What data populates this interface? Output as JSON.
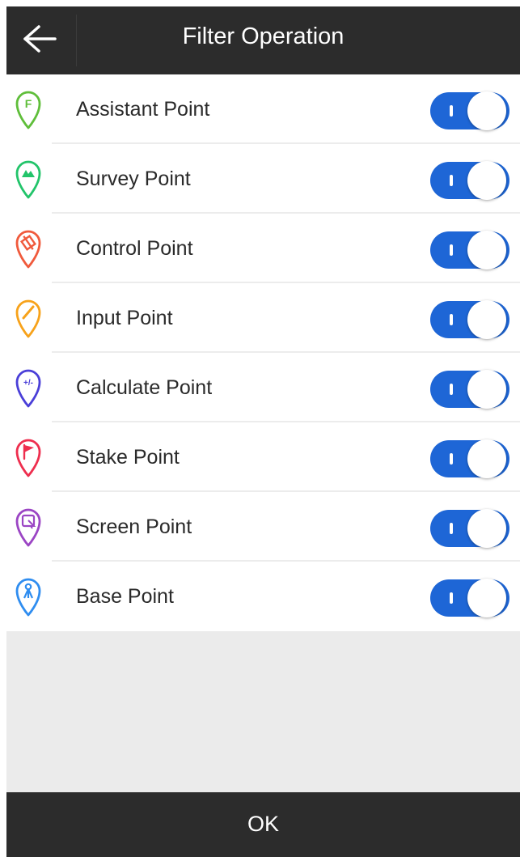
{
  "header": {
    "title": "Filter Operation",
    "back_icon": "arrow-left-icon"
  },
  "point_types": [
    {
      "key": "assistant",
      "label": "Assistant Point",
      "icon": "assistant-point-pin-icon",
      "color": "#5fbe3a",
      "enabled": true
    },
    {
      "key": "survey",
      "label": "Survey Point",
      "icon": "survey-point-pin-icon",
      "color": "#22c46a",
      "enabled": true
    },
    {
      "key": "control",
      "label": "Control Point",
      "icon": "control-point-pin-icon",
      "color": "#f05a3c",
      "enabled": true
    },
    {
      "key": "input",
      "label": "Input Point",
      "icon": "input-point-pin-icon",
      "color": "#f7a21a",
      "enabled": true
    },
    {
      "key": "calculate",
      "label": "Calculate Point",
      "icon": "calculate-point-pin-icon",
      "color": "#4a3fd8",
      "enabled": true
    },
    {
      "key": "stake",
      "label": "Stake Point",
      "icon": "stake-point-pin-icon",
      "color": "#ee2e4e",
      "enabled": true
    },
    {
      "key": "screen",
      "label": "Screen Point",
      "icon": "screen-point-pin-icon",
      "color": "#9b45c4",
      "enabled": true
    },
    {
      "key": "base",
      "label": "Base Point",
      "icon": "base-point-pin-icon",
      "color": "#2f8df0",
      "enabled": true
    }
  ],
  "toggle": {
    "on_color": "#1e66d6"
  },
  "footer": {
    "ok_label": "OK"
  }
}
